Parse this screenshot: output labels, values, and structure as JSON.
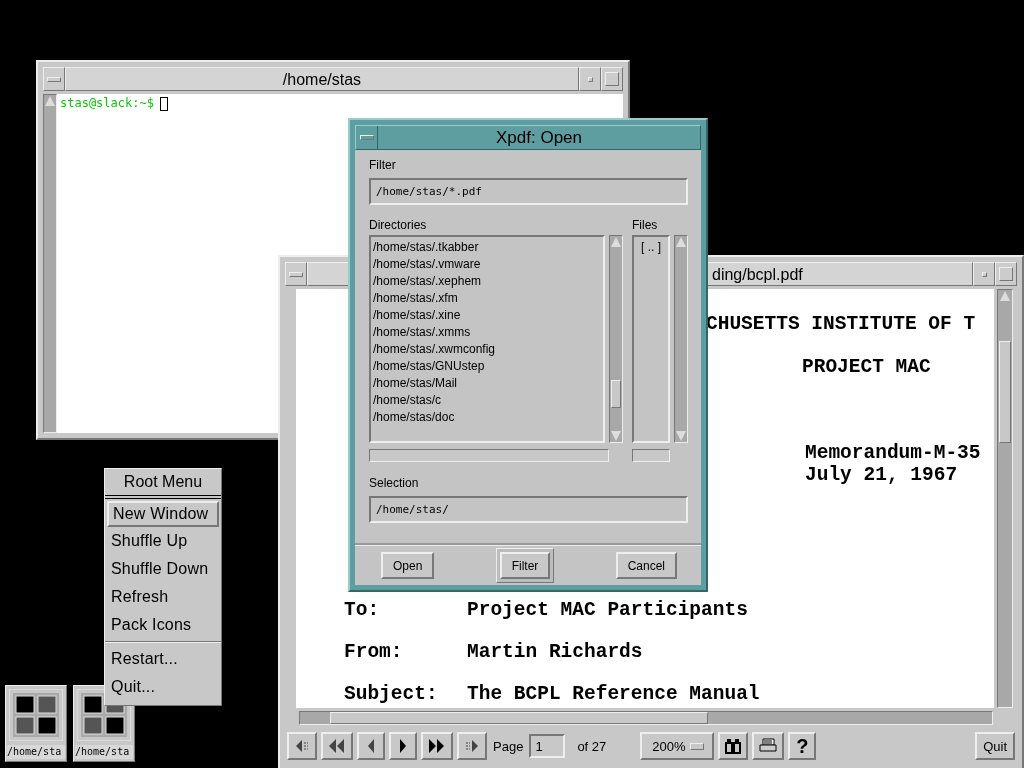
{
  "terminal": {
    "title": "/home/stas",
    "prompt": "stas@slack:~$"
  },
  "viewer": {
    "title": "ding/bcpl.pdf",
    "document": {
      "header": [
        "CHUSETTS INSTITUTE OF T",
        "PROJECT MAC",
        "Memorandum-M-35",
        "July 21, 1967"
      ],
      "fields": [
        {
          "label": "To:",
          "value": "Project MAC Participants"
        },
        {
          "label": "From:",
          "value": "Martin Richards"
        },
        {
          "label": "Subject:",
          "value": "The BCPL Reference Manual"
        }
      ]
    },
    "toolbar": {
      "page_label": "Page",
      "page": "1",
      "page_count": "of 27",
      "zoom": "200%",
      "help": "?",
      "quit": "Quit"
    }
  },
  "dialog": {
    "title": "Xpdf: Open",
    "filter_label": "Filter",
    "filter": "/home/stas/*.pdf",
    "directories_label": "Directories",
    "directories": [
      "/home/stas/.tkabber",
      "/home/stas/.vmware",
      "/home/stas/.xephem",
      "/home/stas/.xfm",
      "/home/stas/.xine",
      "/home/stas/.xmms",
      "/home/stas/.xwmconfig",
      "/home/stas/GNUstep",
      "/home/stas/Mail",
      "/home/stas/c",
      "/home/stas/doc"
    ],
    "files_label": "Files",
    "files": [
      "[ .. ]"
    ],
    "selection_label": "Selection",
    "selection": "/home/stas/",
    "buttons": [
      {
        "label": "Open",
        "default": false
      },
      {
        "label": "Filter",
        "default": true
      },
      {
        "label": "Cancel",
        "default": false
      }
    ]
  },
  "root_menu": {
    "title": "Root Menu",
    "items": [
      {
        "label": "New Window",
        "selected": true,
        "separator_before": false
      },
      {
        "label": "Shuffle Up",
        "selected": false,
        "separator_before": false
      },
      {
        "label": "Shuffle Down",
        "selected": false,
        "separator_before": false
      },
      {
        "label": "Refresh",
        "selected": false,
        "separator_before": false
      },
      {
        "label": "Pack Icons",
        "selected": false,
        "separator_before": false
      },
      {
        "label": "Restart...",
        "selected": false,
        "separator_before": true
      },
      {
        "label": "Quit...",
        "selected": false,
        "separator_before": false
      }
    ]
  },
  "icons": [
    {
      "label": "/home/sta"
    },
    {
      "label": "/home/sta"
    }
  ]
}
